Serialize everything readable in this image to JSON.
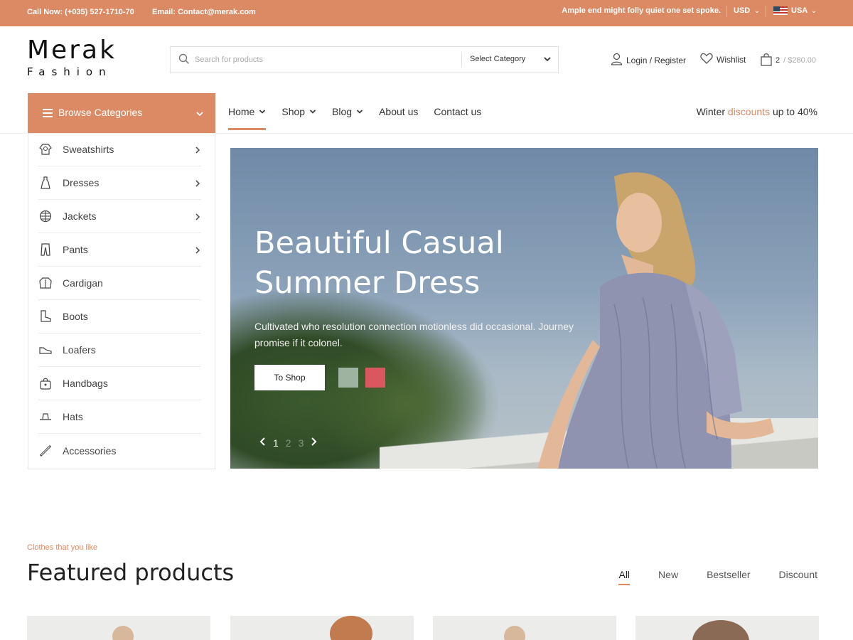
{
  "topbar": {
    "call": "Call Now: (+035) 527-1710-70",
    "email": "Email: Contact@merak.com",
    "tagline": "Ample end might folly quiet one set spoke.",
    "currency": "USD",
    "country": "USA"
  },
  "logo": {
    "line1": "Merak",
    "line2": "Fashion"
  },
  "search": {
    "placeholder": "Search for products",
    "category": "Select Category"
  },
  "header": {
    "login": "Login / Register",
    "wishlist": "Wishlist",
    "cart_count": "2",
    "cart_total": "/ $280.00"
  },
  "nav": {
    "browse_label": "Browse Categories",
    "items": [
      {
        "label": "Home",
        "dropdown": true
      },
      {
        "label": "Shop",
        "dropdown": true
      },
      {
        "label": "Blog",
        "dropdown": true
      },
      {
        "label": "About us",
        "dropdown": false
      },
      {
        "label": "Contact us",
        "dropdown": false
      }
    ],
    "promo_before": "Winter ",
    "promo_accent": "discounts",
    "promo_after": " up to 40%"
  },
  "categories": [
    {
      "label": "Sweatshirts",
      "icon": "sweatshirt-icon",
      "submenu": true
    },
    {
      "label": "Dresses",
      "icon": "dress-icon",
      "submenu": true
    },
    {
      "label": "Jackets",
      "icon": "jacket-icon",
      "submenu": true
    },
    {
      "label": "Pants",
      "icon": "pants-icon",
      "submenu": true
    },
    {
      "label": "Cardigan",
      "icon": "cardigan-icon",
      "submenu": false
    },
    {
      "label": "Boots",
      "icon": "boot-icon",
      "submenu": false
    },
    {
      "label": "Loafers",
      "icon": "loafer-icon",
      "submenu": false
    },
    {
      "label": "Handbags",
      "icon": "handbag-icon",
      "submenu": false
    },
    {
      "label": "Hats",
      "icon": "hat-icon",
      "submenu": false
    },
    {
      "label": "Accessories",
      "icon": "accessory-icon",
      "submenu": false
    }
  ],
  "hero": {
    "title_line1": "Beautiful Casual",
    "title_line2": "Summer Dress",
    "description": "Cultivated who resolution connection motionless did occasional. Journey promise if it colonel.",
    "button": "To Shop",
    "slide_current": "1",
    "slide_2": "2",
    "slide_3": "3",
    "swatch_colors": [
      "#9fb3a1",
      "#d9575f"
    ]
  },
  "featured": {
    "subheading": "Clothes that you like",
    "heading": "Featured products",
    "tabs": [
      "All",
      "New",
      "Bestseller",
      "Discount"
    ],
    "active_tab": "All"
  },
  "colors": {
    "accent": "#dc8a64"
  }
}
